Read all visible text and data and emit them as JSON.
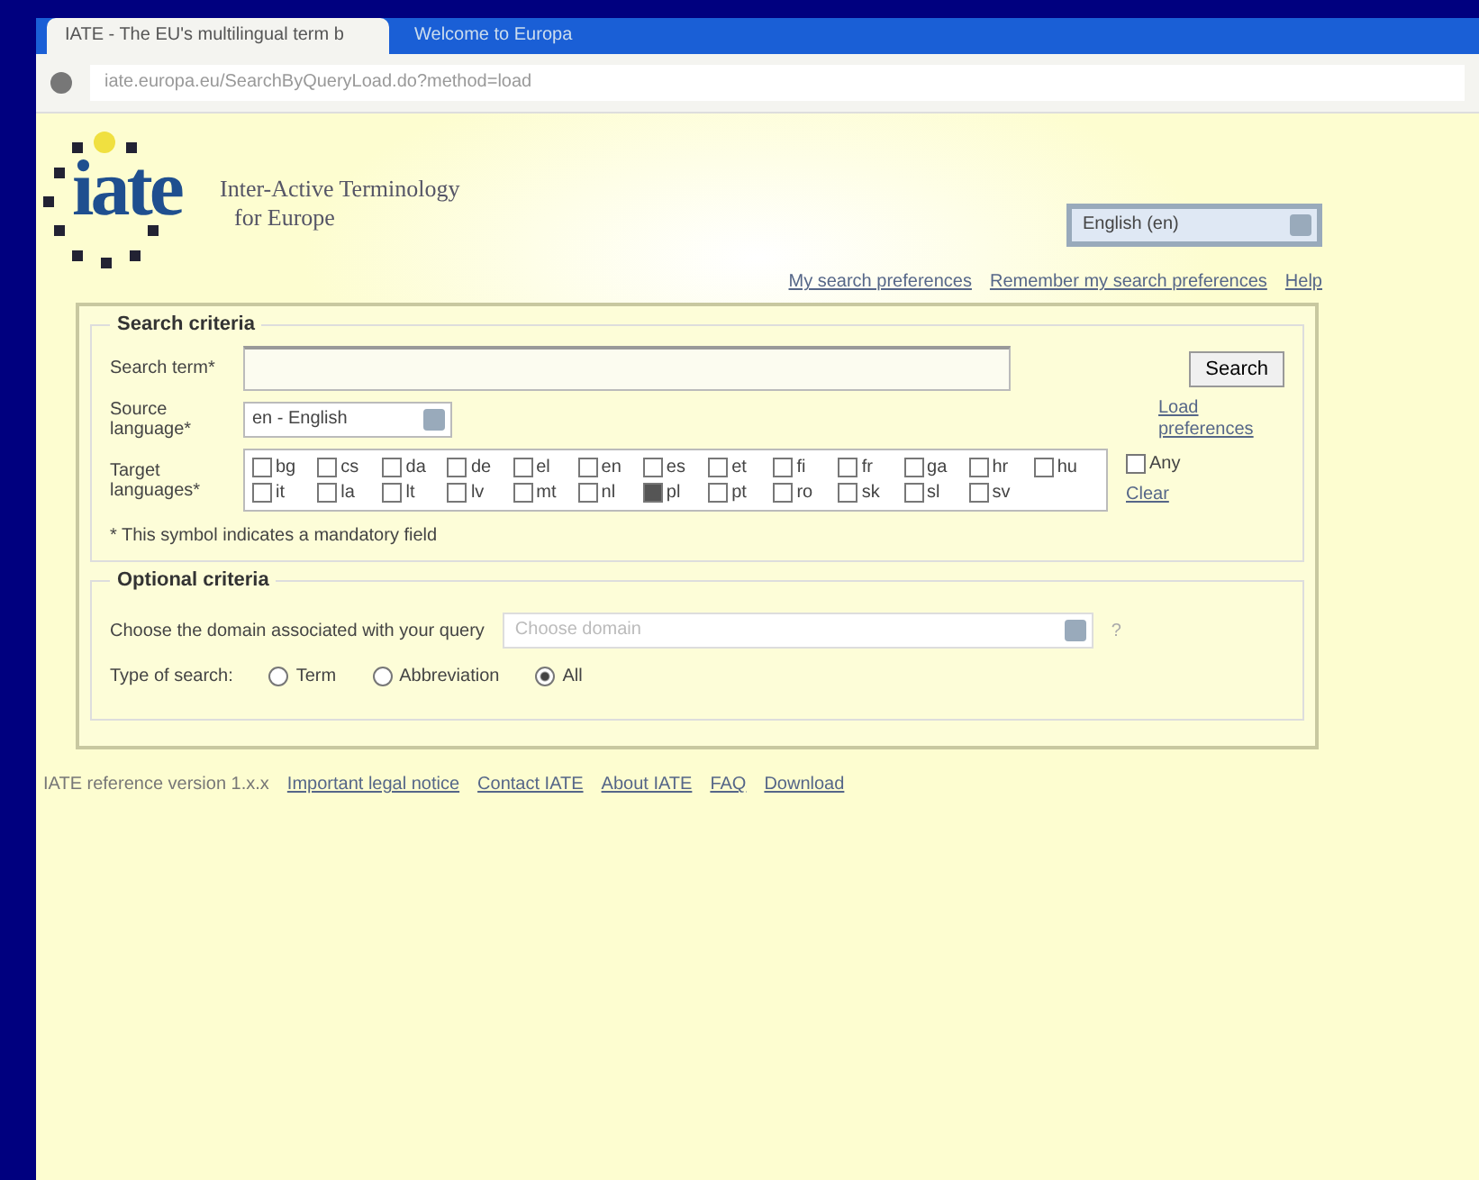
{
  "browser": {
    "tabs": [
      {
        "title": "IATE - The EU's multilingual term b",
        "selected": true
      },
      {
        "title": "Welcome to Europa",
        "selected": false
      }
    ],
    "address": "iate.europa.eu/SearchByQueryLoad.do?method=load"
  },
  "header": {
    "logo": "iate",
    "tagline": [
      "Inter-Active Terminology",
      "for Europe"
    ],
    "interface_language": "English (en)",
    "links": [
      "My search preferences",
      "Remember my search preferences",
      "Help"
    ]
  },
  "search_criteria": {
    "legend": "Search criteria",
    "term_label": "Search term*",
    "search_button": "Search",
    "source_label": "Source language*",
    "source_value": "en - English",
    "load_link": "Load preferences",
    "target_label": "Target languages*",
    "targets": [
      {
        "code": "bg",
        "checked": false
      },
      {
        "code": "cs",
        "checked": false
      },
      {
        "code": "da",
        "checked": false
      },
      {
        "code": "de",
        "checked": false
      },
      {
        "code": "el",
        "checked": false
      },
      {
        "code": "en",
        "checked": false
      },
      {
        "code": "es",
        "checked": false
      },
      {
        "code": "et",
        "checked": false
      },
      {
        "code": "fi",
        "checked": false
      },
      {
        "code": "fr",
        "checked": false
      },
      {
        "code": "ga",
        "checked": false
      },
      {
        "code": "hr",
        "checked": false
      },
      {
        "code": "hu",
        "checked": false
      },
      {
        "code": "it",
        "checked": false
      },
      {
        "code": "la",
        "checked": false
      },
      {
        "code": "lt",
        "checked": false
      },
      {
        "code": "lv",
        "checked": false
      },
      {
        "code": "mt",
        "checked": false
      },
      {
        "code": "nl",
        "checked": false
      },
      {
        "code": "pl",
        "checked": true
      },
      {
        "code": "pt",
        "checked": false
      },
      {
        "code": "ro",
        "checked": false
      },
      {
        "code": "sk",
        "checked": false
      },
      {
        "code": "sl",
        "checked": false
      },
      {
        "code": "sv",
        "checked": false
      }
    ],
    "any": {
      "label": "Any",
      "checked": false
    },
    "clear_link": "Clear",
    "note": "* This symbol indicates a mandatory field"
  },
  "optional_criteria": {
    "legend": "Optional criteria",
    "domain_label": "Choose the domain associated with your query",
    "domain_placeholder": "Choose domain",
    "domain_help": "?",
    "type_label": "Type of search:",
    "types": [
      {
        "label": "Term",
        "selected": false
      },
      {
        "label": "Abbreviation",
        "selected": false
      },
      {
        "label": "All",
        "selected": true
      }
    ]
  },
  "footer": {
    "version": "IATE reference version 1.x.x",
    "links": [
      "Important legal notice",
      "Contact IATE",
      "About IATE",
      "FAQ",
      "Download"
    ]
  }
}
